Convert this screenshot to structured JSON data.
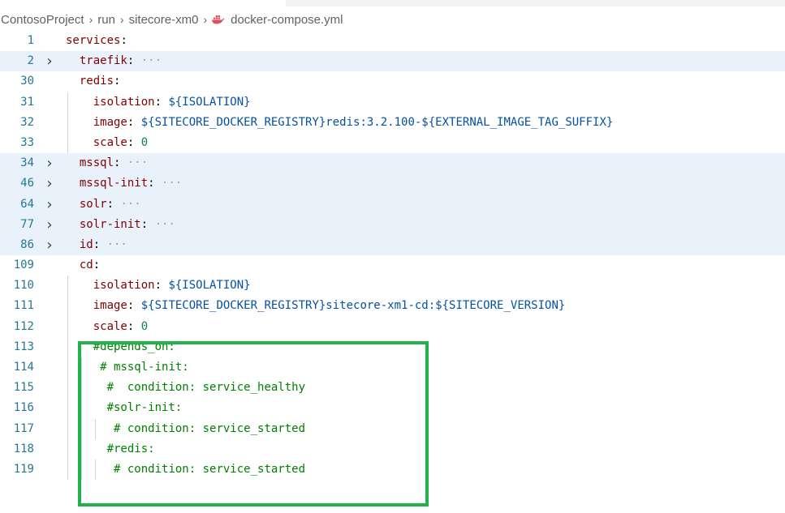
{
  "breadcrumb": {
    "items": [
      "ContosoProject",
      "run",
      "sitecore-xm0"
    ],
    "separator": "›",
    "file": "docker-compose.yml",
    "file_icon": "docker-icon"
  },
  "colors": {
    "key": "#800000",
    "value": "#0451a5",
    "number": "#098658",
    "comment": "#008000",
    "line_number": "#237893",
    "folded_highlight": "#e9f1fb",
    "annotation_box": "#22b14c"
  },
  "editor": {
    "language": "yaml",
    "fold_icon": "chevron-right-icon",
    "lines": [
      {
        "n": "1",
        "code": "services:"
      },
      {
        "n": "2",
        "code": "  traefik: ···",
        "folded": true
      },
      {
        "n": "30",
        "code": "  redis:"
      },
      {
        "n": "31",
        "code": "    isolation: ${ISOLATION}"
      },
      {
        "n": "32",
        "code": "    image: ${SITECORE_DOCKER_REGISTRY}redis:3.2.100-${EXTERNAL_IMAGE_TAG_SUFFIX}"
      },
      {
        "n": "33",
        "code": "    scale: 0"
      },
      {
        "n": "34",
        "code": "  mssql: ···",
        "folded": true
      },
      {
        "n": "46",
        "code": "  mssql-init: ···",
        "folded": true
      },
      {
        "n": "64",
        "code": "  solr: ···",
        "folded": true
      },
      {
        "n": "77",
        "code": "  solr-init: ···",
        "folded": true
      },
      {
        "n": "86",
        "code": "  id: ···",
        "folded": true
      },
      {
        "n": "109",
        "code": "  cd:"
      },
      {
        "n": "110",
        "code": "    isolation: ${ISOLATION}"
      },
      {
        "n": "111",
        "code": "    image: ${SITECORE_DOCKER_REGISTRY}sitecore-xm1-cd:${SITECORE_VERSION}"
      },
      {
        "n": "112",
        "code": "    scale: 0"
      },
      {
        "n": "113",
        "code": "    #depends_on:"
      },
      {
        "n": "114",
        "code": "     # mssql-init:"
      },
      {
        "n": "115",
        "code": "      #  condition: service_healthy"
      },
      {
        "n": "116",
        "code": "      #solr-init:"
      },
      {
        "n": "117",
        "code": "       # condition: service_started"
      },
      {
        "n": "118",
        "code": "      #redis:"
      },
      {
        "n": "119",
        "code": "       # condition: service_started"
      }
    ]
  }
}
